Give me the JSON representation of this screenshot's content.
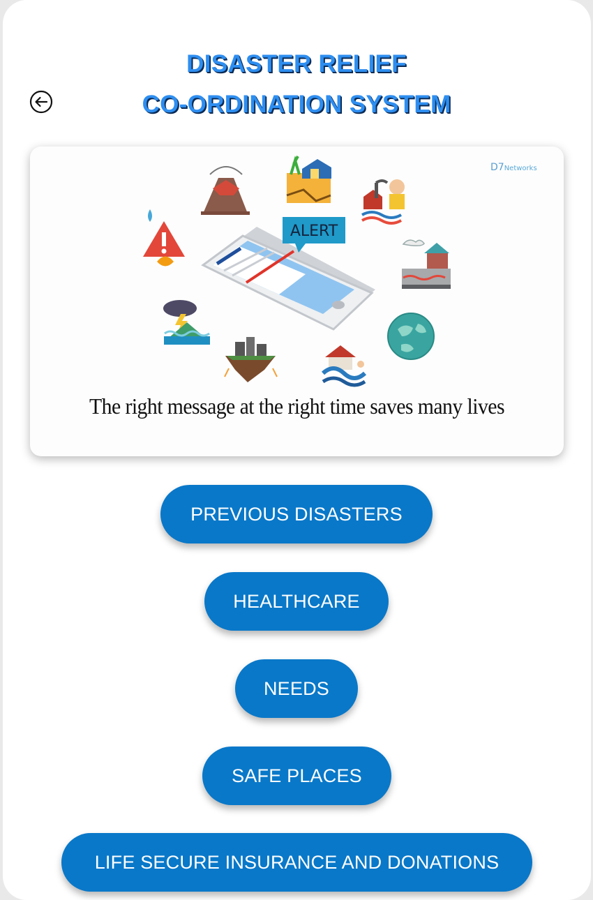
{
  "header": {
    "title_line1": "DISASTER RELIEF",
    "title_line2": "CO-ORDINATION SYSTEM",
    "back_icon": "arrow-left-circle-icon"
  },
  "banner": {
    "alert_label": "ALERT",
    "tagline": "The right message at the right time saves many lives",
    "brand_letter": "D7",
    "brand_name": "Networks"
  },
  "menu": {
    "previous_disasters": "PREVIOUS DISASTERS",
    "healthcare": "HEALTHCARE",
    "needs": "NEEDS",
    "safe_places": "SAFE PLACES",
    "insurance_donations": "LIFE SECURE INSURANCE AND DONATIONS"
  },
  "colors": {
    "button_bg": "#0978c9",
    "title_blue": "#2e8ef0",
    "title_shadow": "#0a2a55"
  }
}
